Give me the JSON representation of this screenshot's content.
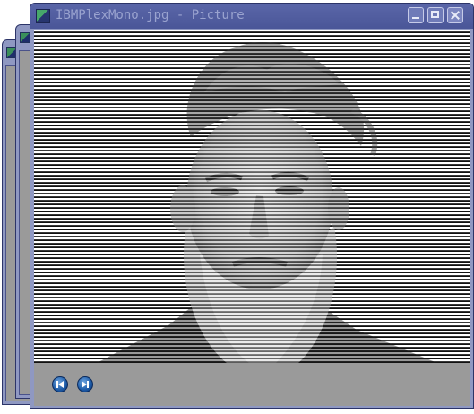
{
  "window": {
    "title": "IBMPlexMono.jpg - Picture"
  },
  "image": {
    "description_icon": "picture-icon"
  },
  "controls": {
    "prev_icon": "skip-back-icon",
    "next_icon": "skip-forward-icon"
  },
  "colors": {
    "titlebar": "#4a5698",
    "frame": "#8f98c2",
    "control_bar": "#9a9a9a",
    "nav_button": "#1c5aa6"
  }
}
